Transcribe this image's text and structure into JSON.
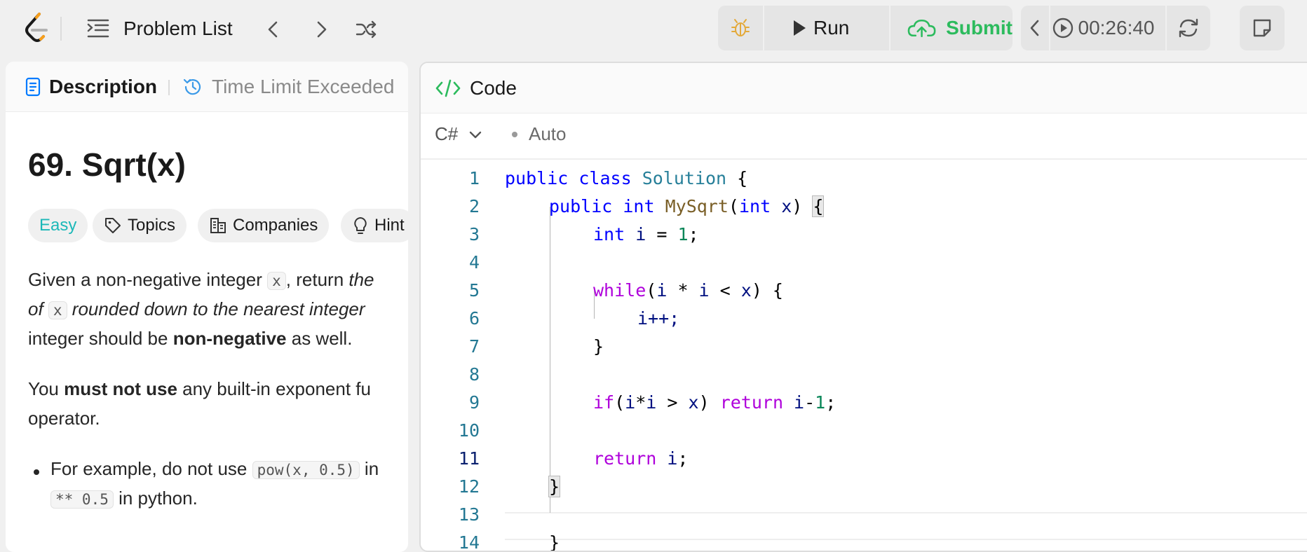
{
  "topbar": {
    "problem_list_label": "Problem List",
    "run_label": "Run",
    "submit_label": "Submit",
    "timer": "00:26:40"
  },
  "left_tabs": {
    "description": "Description",
    "submission": "Time Limit Exceeded"
  },
  "problem": {
    "title": "69. Sqrt(x)",
    "tags": {
      "difficulty": "Easy",
      "topics": "Topics",
      "companies": "Companies",
      "hint": "Hint"
    },
    "para1": {
      "line1_a": "Given a non-negative integer ",
      "line1_code": "x",
      "line1_b": ", return ",
      "line1_c": "the",
      "line2_a": "of ",
      "line2_code": "x",
      "line2_b": " rounded down to the nearest integer",
      "line3_a": "integer should be ",
      "line3_bold": "non-negative",
      "line3_b": " as well."
    },
    "para2": {
      "line1_a": "You ",
      "line1_bold": "must not use",
      "line1_b": " any built-in exponent fu",
      "line2": "operator."
    },
    "bullet": {
      "line1_a": "For example, do not use ",
      "line1_code": "pow(x, 0.5)",
      "line1_b": " in",
      "line2_code": "** 0.5",
      "line2_b": " in python."
    }
  },
  "editor": {
    "header": "Code",
    "language": "C#",
    "mode": "Auto",
    "line_numbers": [
      "1",
      "2",
      "3",
      "4",
      "5",
      "6",
      "7",
      "8",
      "9",
      "10",
      "11",
      "12",
      "13",
      "14"
    ],
    "active_line": "11",
    "code": {
      "l1_kw1": "public",
      "l1_kw2": "class",
      "l1_cls": "Solution",
      "l1_end": " {",
      "l2_kw1": "public",
      "l2_kw2": "int",
      "l2_fn": "MySqrt",
      "l2_p1": "(",
      "l2_kw3": "int",
      "l2_var": "x",
      "l2_p2": ") ",
      "l2_brace": "{",
      "l3_kw": "int",
      "l3_var": "i",
      "l3_op": " = ",
      "l3_num": "1",
      "l3_end": ";",
      "l5_kw": "while",
      "l5_rest_a": "(",
      "l5_v1": "i",
      "l5_op1": " * ",
      "l5_v2": "i",
      "l5_op2": " < ",
      "l5_v3": "x",
      "l5_end": ") {",
      "l6": "i++;",
      "l7": "}",
      "l9_kw": "if",
      "l9_a": "(",
      "l9_v1": "i",
      "l9_op": "*",
      "l9_v2": "i",
      "l9_b": " > ",
      "l9_v3": "x",
      "l9_c": ") ",
      "l9_ret": "return",
      "l9_v4": " i",
      "l9_minus": "-",
      "l9_num": "1",
      "l9_end": ";",
      "l11_ret": "return",
      "l11_v": " i",
      "l11_end": ";",
      "l12": "}",
      "l14": "}"
    }
  },
  "colors": {
    "easy": "#1cb8b8",
    "submit": "#2cbb5d",
    "debug_icon": "#e3a93a",
    "line_number": "#237893"
  }
}
